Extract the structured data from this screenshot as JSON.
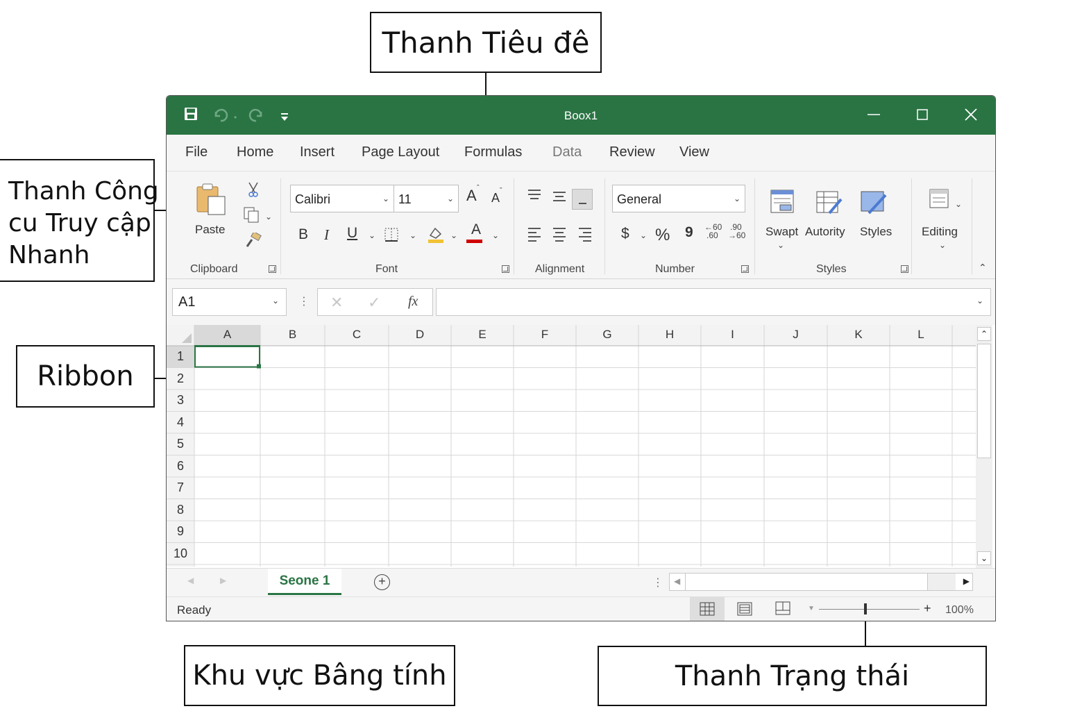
{
  "callouts": {
    "title_bar": "Thanh Tiêu đê",
    "quick_access": [
      "Thanh Công",
      "cu Truy cập",
      "Nhanh"
    ],
    "ribbon": "Ribbon",
    "sheet_area": "Khu vực Bâng tính",
    "status_bar": "Thanh Trạng thái"
  },
  "window": {
    "title": "Boox1",
    "accent_color": "#2a7444"
  },
  "tabs": [
    "File",
    "Home",
    "Insert",
    "Page Layout",
    "Formulas",
    "Data",
    "Review",
    "View"
  ],
  "ribbon": {
    "clipboard": {
      "paste_label": "Paste",
      "group_label": "Clipboard"
    },
    "font": {
      "font_name": "Calibri",
      "font_size": "11",
      "group_label": "Font",
      "bold": "B",
      "italic": "I",
      "underline": "U",
      "grow": "A",
      "shrink": "A",
      "color": "A"
    },
    "alignment": {
      "group_label": "Alignment"
    },
    "number": {
      "format": "General",
      "group_label": "Number",
      "currency": "$",
      "percent": "%",
      "comma": "9",
      "inc_decimal_top": "←60",
      "inc_decimal_bottom": ".60",
      "dec_decimal_top": ".90",
      "dec_decimal_bottom": "→60"
    },
    "styles": {
      "group_label": "Styles",
      "items": [
        "Swapt",
        "Autority",
        "Styles"
      ]
    },
    "editing": {
      "label": "Editing"
    }
  },
  "formula_bar": {
    "name_box": "A1",
    "fx": "fx",
    "value": ""
  },
  "grid": {
    "columns": [
      "A",
      "B",
      "C",
      "D",
      "E",
      "F",
      "G",
      "H",
      "I",
      "J",
      "K",
      "L"
    ],
    "rows": [
      "1",
      "2",
      "3",
      "4",
      "5",
      "6",
      "7",
      "8",
      "9",
      "10"
    ],
    "active_cell": "A1"
  },
  "sheets": {
    "tabs": [
      "Seone 1"
    ]
  },
  "status": {
    "text": "Ready",
    "zoom": "100%"
  }
}
